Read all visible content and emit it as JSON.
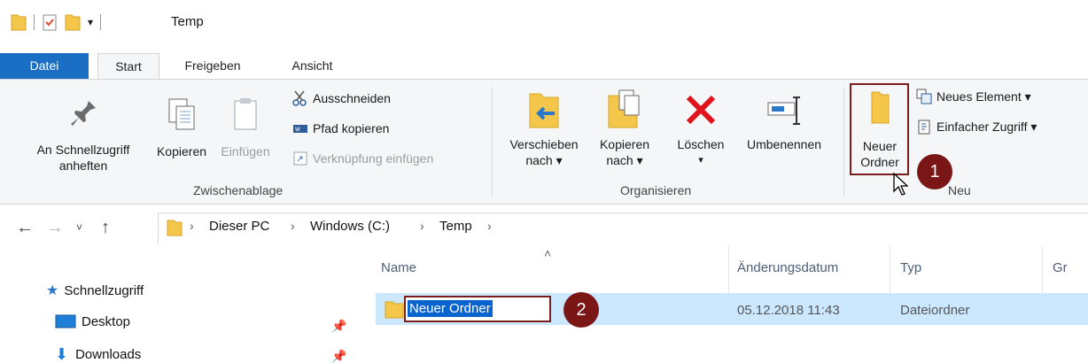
{
  "window": {
    "title": "Temp"
  },
  "ribbon_tabs": [
    "Datei",
    "Start",
    "Freigeben",
    "Ansicht"
  ],
  "clipboard": {
    "pin_line1": "An Schnellzugriff",
    "pin_line2": "anheften",
    "copy": "Kopieren",
    "paste": "Einfügen",
    "cut": "Ausschneiden",
    "copy_path": "Pfad kopieren",
    "paste_shortcut": "Verknüpfung einfügen",
    "group_label": "Zwischenablage"
  },
  "organize": {
    "move_line1": "Verschieben",
    "move_line2": "nach ▾",
    "copyto_line1": "Kopieren",
    "copyto_line2": "nach ▾",
    "delete": "Löschen",
    "delete_arrow": "▾",
    "rename": "Umbenennen",
    "group_label": "Organisieren"
  },
  "new": {
    "new_folder_line1": "Neuer",
    "new_folder_line2": "Ordner",
    "new_item": "Neues Element ▾",
    "easy_access": "Einfacher Zugriff ▾",
    "group_label": "Neu"
  },
  "address": {
    "crumbs": [
      "Dieser PC",
      "Windows (C:)",
      "Temp"
    ],
    "separator": "›"
  },
  "nav": {
    "quick_access": "Schnellzugriff",
    "items": [
      "Desktop",
      "Downloads"
    ]
  },
  "columns": [
    "Name",
    "Änderungsdatum",
    "Typ",
    "Gr"
  ],
  "rows": [
    {
      "name": "Neuer Ordner",
      "date": "05.12.2018 11:43",
      "type": "Dateiordner"
    }
  ],
  "callouts": [
    "1",
    "2"
  ],
  "colors": {
    "accent": "#1a6fc4",
    "callout": "#7a1616",
    "selection": "#cce8ff",
    "folder": "#f4c64a"
  }
}
